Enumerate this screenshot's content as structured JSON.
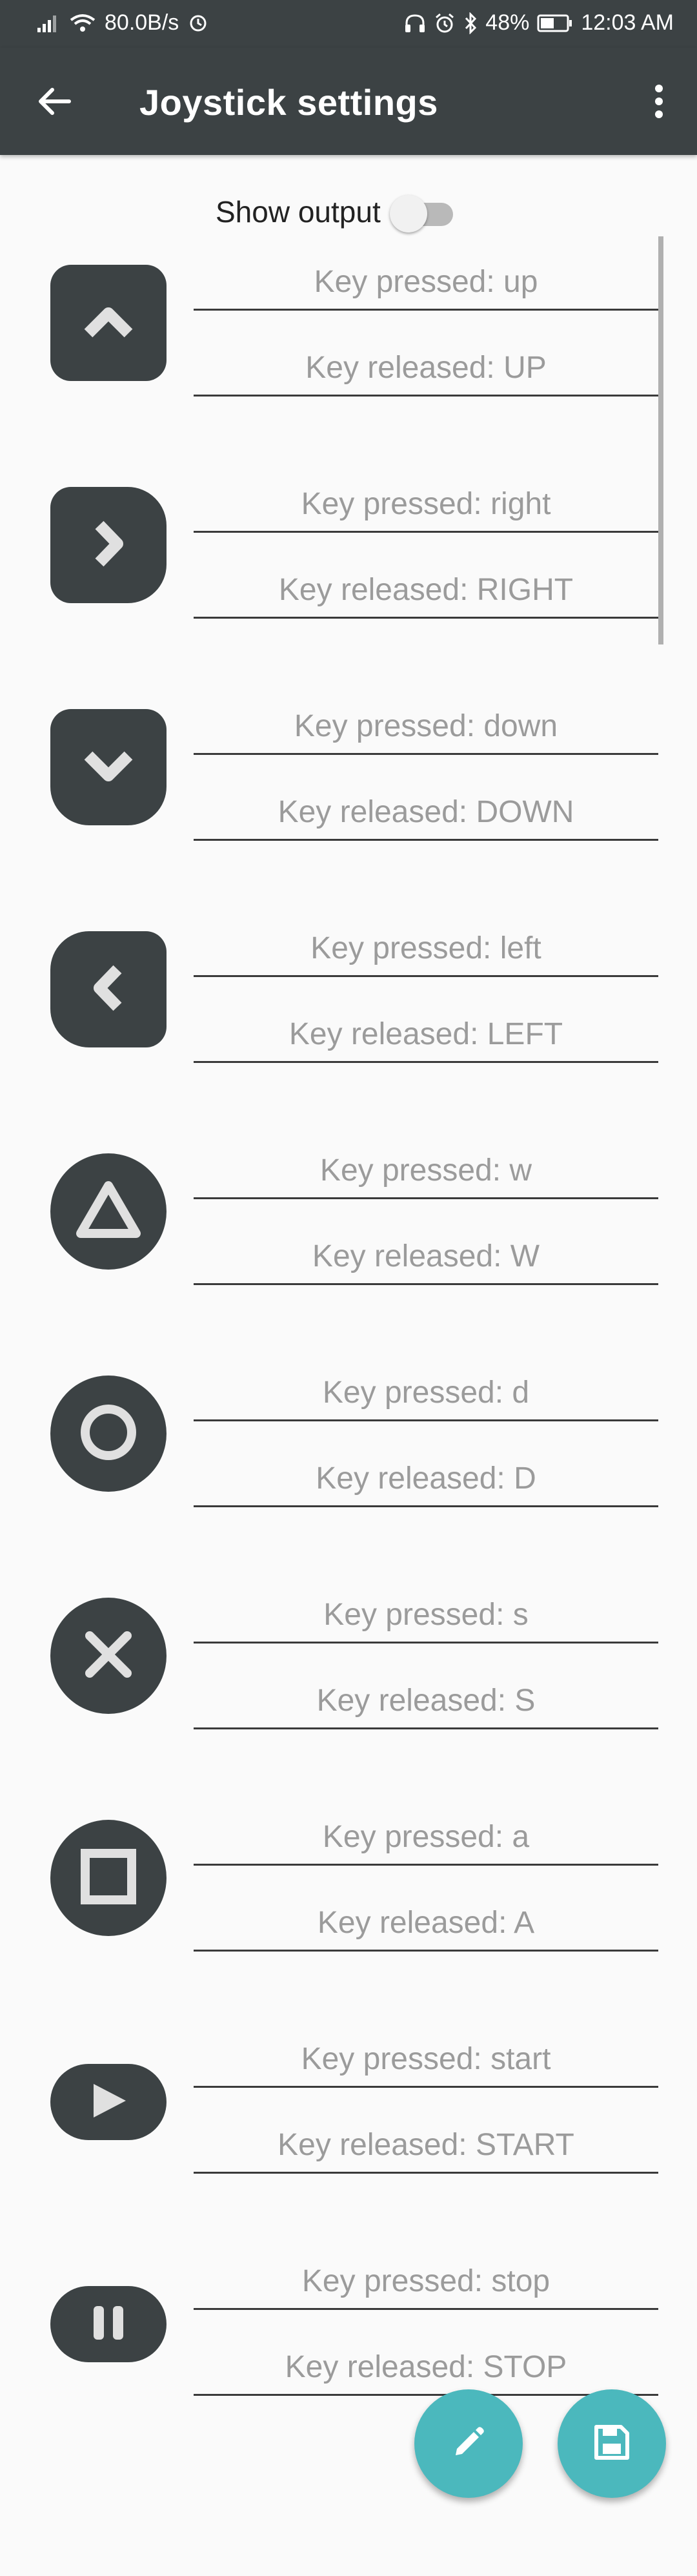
{
  "status_bar": {
    "network_speed": "80.0B/s",
    "battery": "48%",
    "time": "12:03 AM"
  },
  "toolbar": {
    "title": "Joystick settings"
  },
  "show_output": {
    "label": "Show output",
    "enabled": false
  },
  "buttons": [
    {
      "icon": "chevron-up-icon",
      "pressed": "Key pressed: up",
      "released": "Key released: UP"
    },
    {
      "icon": "chevron-right-icon",
      "pressed": "Key pressed: right",
      "released": "Key released: RIGHT"
    },
    {
      "icon": "chevron-down-icon",
      "pressed": "Key pressed: down",
      "released": "Key released: DOWN"
    },
    {
      "icon": "chevron-left-icon",
      "pressed": "Key pressed: left",
      "released": "Key released: LEFT"
    },
    {
      "icon": "triangle-icon",
      "pressed": "Key pressed: w",
      "released": "Key released: W"
    },
    {
      "icon": "circle-icon",
      "pressed": "Key pressed: d",
      "released": "Key released: D"
    },
    {
      "icon": "cross-icon",
      "pressed": "Key pressed: s",
      "released": "Key released: S"
    },
    {
      "icon": "square-icon",
      "pressed": "Key pressed: a",
      "released": "Key released: A"
    },
    {
      "icon": "play-icon",
      "pressed": "Key pressed: start",
      "released": "Key released: START"
    },
    {
      "icon": "pause-icon",
      "pressed": "Key pressed: stop",
      "released": "Key released: STOP"
    }
  ],
  "fabs": {
    "edit_icon": "pencil-icon",
    "save_icon": "floppy-disk-icon"
  },
  "colors": {
    "toolbar": "#3c4244",
    "button": "#3c4244",
    "fab": "#4bb8bd",
    "background": "#fafafa"
  }
}
